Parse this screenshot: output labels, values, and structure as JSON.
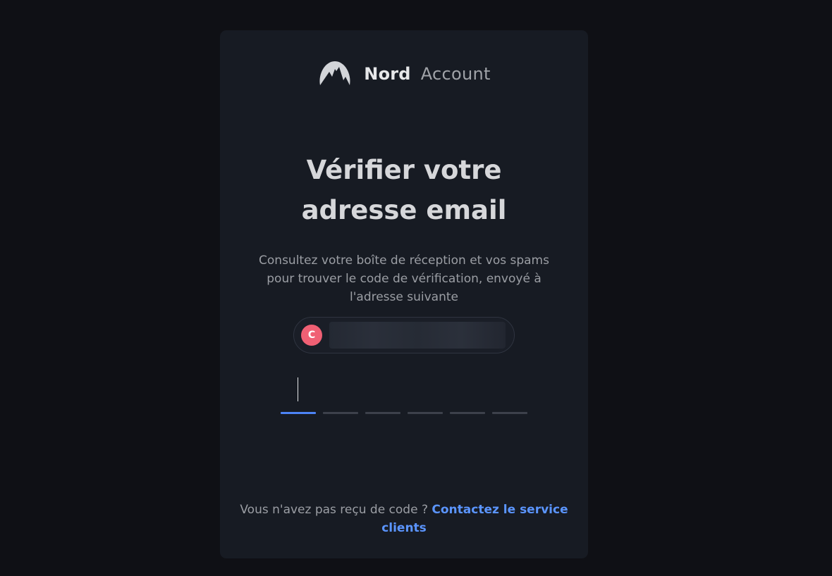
{
  "brand": {
    "logo_icon": "nord-mountain-logo-icon",
    "name": "Nord",
    "product": "Account"
  },
  "verify": {
    "title": "Vérifier votre adresse email",
    "description": "Consultez votre boîte de réception et vos spams pour trouver le code de vérification, envoyé à l'adresse suivante"
  },
  "email": {
    "avatar_initial": "C",
    "address_redacted": true
  },
  "code": {
    "length": 6,
    "active_slot": 1
  },
  "footer": {
    "question": "Vous n'avez pas reçu de code ?",
    "contact_link": "Contactez le service clients"
  },
  "colors": {
    "background": "#0f1015",
    "card": "#171b23",
    "accent": "#4d84f5",
    "link": "#5b95ff",
    "avatar": "#f06074"
  }
}
